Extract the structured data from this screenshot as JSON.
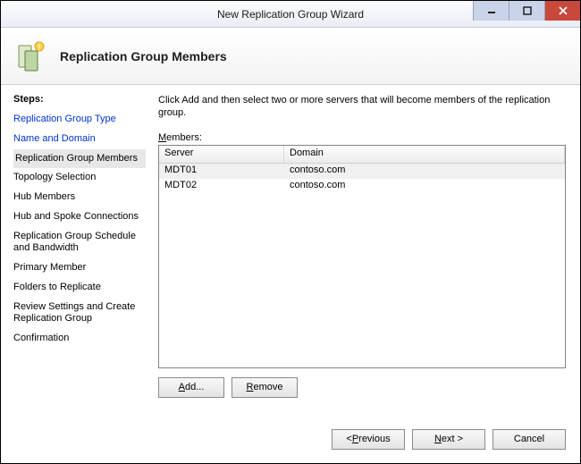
{
  "window": {
    "title": "New Replication Group Wizard"
  },
  "header": {
    "title": "Replication Group Members"
  },
  "sidebar": {
    "steps_label": "Steps:",
    "items": [
      {
        "label": "Replication Group Type",
        "state": "done"
      },
      {
        "label": "Name and Domain",
        "state": "done"
      },
      {
        "label": "Replication Group Members",
        "state": "current"
      },
      {
        "label": "Topology Selection",
        "state": "pending"
      },
      {
        "label": "Hub Members",
        "state": "pending"
      },
      {
        "label": "Hub and Spoke Connections",
        "state": "pending"
      },
      {
        "label": "Replication Group Schedule and Bandwidth",
        "state": "pending"
      },
      {
        "label": "Primary Member",
        "state": "pending"
      },
      {
        "label": "Folders to Replicate",
        "state": "pending"
      },
      {
        "label": "Review Settings and Create Replication Group",
        "state": "pending"
      },
      {
        "label": "Confirmation",
        "state": "pending"
      }
    ]
  },
  "main": {
    "instruction": "Click Add and then select two or more servers that will become members of the replication group.",
    "members_label_prefix": "M",
    "members_label_rest": "embers:",
    "columns": {
      "server": "Server",
      "domain": "Domain"
    },
    "rows": [
      {
        "server": "MDT01",
        "domain": "contoso.com",
        "selected": true
      },
      {
        "server": "MDT02",
        "domain": "contoso.com",
        "selected": false
      }
    ],
    "add_underline": "A",
    "add_rest": "dd...",
    "remove_underline": "R",
    "remove_rest": "emove"
  },
  "footer": {
    "prev_prefix": "< ",
    "prev_underline": "P",
    "prev_rest": "revious",
    "next_underline": "N",
    "next_rest": "ext >",
    "cancel": "Cancel"
  }
}
